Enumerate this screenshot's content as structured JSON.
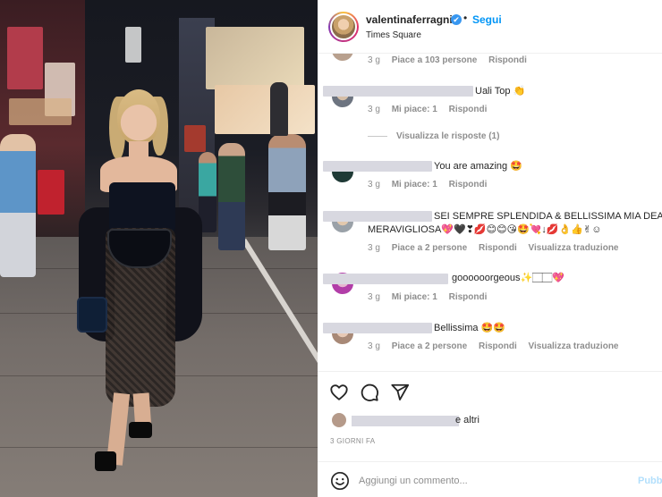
{
  "post": {
    "username": "valentinaferragni",
    "verified_mark": "✔",
    "separator": "•",
    "follow_label": "Segui",
    "location": "Times Square"
  },
  "comments": [
    {
      "text": "",
      "time": "3 g",
      "likes": "Piace a 103 persone",
      "reply": "Rispondi"
    },
    {
      "text": "Uali Top 👏",
      "time": "3 g",
      "likes": "Mi piace: 1",
      "reply": "Rispondi",
      "view_replies": "Visualizza le risposte (1)"
    },
    {
      "text": "You are amazing 🤩",
      "time": "3 g",
      "likes": "Mi piace: 1",
      "reply": "Rispondi"
    },
    {
      "text_line1": "SEI SEMPRE SPLENDIDA & BELLISSIMA MIA DEA",
      "text_line2": "MERAVIGLIOSA💖🖤❣💋😊😊😘🤩💘↓💋👌👍✌☺",
      "time": "3 g",
      "likes": "Piace a 2 persone",
      "reply": "Rispondi",
      "translate": "Visualizza traduzione"
    },
    {
      "text": "goooooorgeous✨🏻🏻💖",
      "time": "3 g",
      "likes": "Mi piace: 1",
      "reply": "Rispondi"
    },
    {
      "text": "Bellissima 🤩🤩",
      "time": "3 g",
      "likes": "Piace a 2 persone",
      "reply": "Rispondi",
      "translate": "Visualizza traduzione"
    }
  ],
  "actions": {
    "like_icon": "heart-icon",
    "comment_icon": "comment-icon",
    "share_icon": "share-icon"
  },
  "liked_by": {
    "suffix": "e altri"
  },
  "timestamp": "3 GIORNI FA",
  "composer": {
    "placeholder": "Aggiungi un commento...",
    "post_label": "Pubblica",
    "emoji_icon": "smile-icon"
  },
  "colors": {
    "accent": "#0095f6",
    "secondary_text": "#8e8e8e",
    "redaction": "#d8d8e0"
  }
}
